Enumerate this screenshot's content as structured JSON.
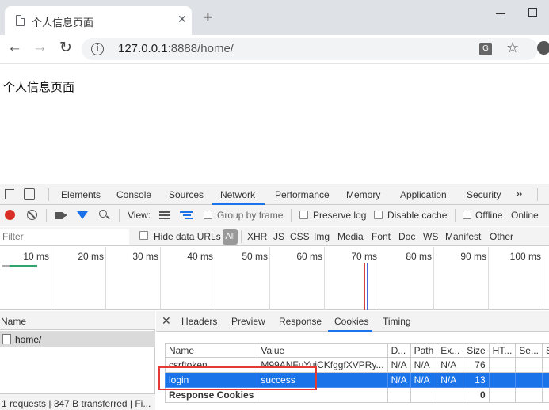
{
  "browser": {
    "tab_title": "个人信息页面",
    "tab_close": "✕",
    "new_tab": "+",
    "url_host": "127.0.0.1",
    "url_rest": ":8888/home/"
  },
  "page": {
    "heading": "个人信息页面"
  },
  "devtools": {
    "main_tabs": [
      "Elements",
      "Console",
      "Sources",
      "Network",
      "Performance",
      "Memory",
      "Application",
      "Security"
    ],
    "active_main_tab": "Network",
    "more": "»",
    "toolbar": {
      "view_label": "View:",
      "group_by_frame": "Group by frame",
      "preserve_log": "Preserve log",
      "disable_cache": "Disable cache",
      "offline": "Offline",
      "online": "Online"
    },
    "filter_bar": {
      "filter_placeholder": "Filter",
      "hide_data_urls": "Hide data URLs",
      "types": [
        "All",
        "XHR",
        "JS",
        "CSS",
        "Img",
        "Media",
        "Font",
        "Doc",
        "WS",
        "Manifest",
        "Other"
      ]
    },
    "overview_ticks": [
      "10 ms",
      "20 ms",
      "30 ms",
      "40 ms",
      "50 ms",
      "60 ms",
      "70 ms",
      "80 ms",
      "90 ms",
      "100 ms"
    ],
    "requests": {
      "column": "Name",
      "items": [
        "home/"
      ],
      "status": "1 requests  |  347 B transferred  |  Fi..."
    },
    "detail_tabs": [
      "Headers",
      "Preview",
      "Response",
      "Cookies",
      "Timing"
    ],
    "active_detail_tab": "Cookies",
    "cookies": {
      "columns": [
        "Name",
        "Value",
        "D...",
        "Path",
        "Ex...",
        "Size",
        "HT...",
        "Se...",
        "S"
      ],
      "rows": [
        [
          "csrftoken",
          "M99ANFuYuiCKfggfXVPRy...",
          "N/A",
          "N/A",
          "N/A",
          "76",
          "",
          "",
          ""
        ],
        [
          "login",
          "success",
          "N/A",
          "N/A",
          "N/A",
          "13",
          "",
          "",
          ""
        ]
      ],
      "group_row": [
        "Response Cookies",
        "",
        "",
        "",
        "",
        "0",
        "",
        "",
        ""
      ]
    }
  }
}
